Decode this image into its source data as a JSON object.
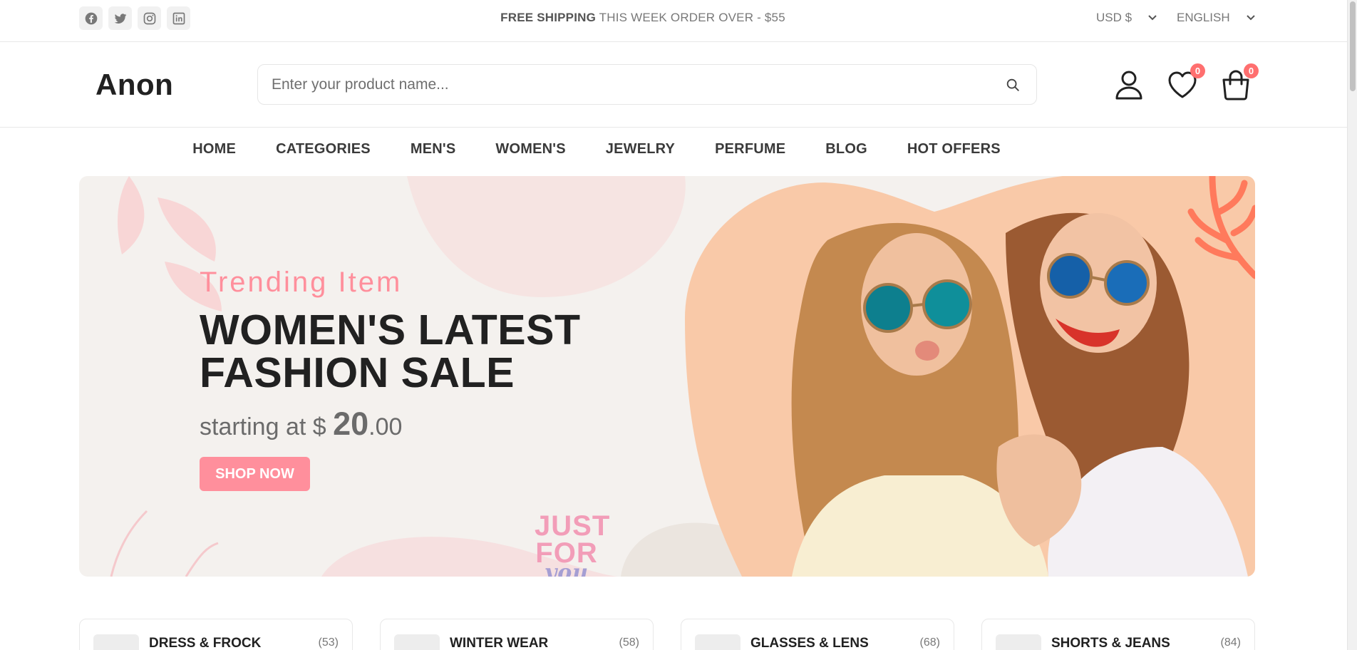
{
  "topbar": {
    "social_icons": [
      "facebook-icon",
      "twitter-icon",
      "instagram-icon",
      "linkedin-icon"
    ],
    "shipping_strong": "FREE SHIPPING",
    "shipping_rest": " THIS WEEK ORDER OVER - $55",
    "currency": "USD $",
    "language": "ENGLISH"
  },
  "header": {
    "logo": "Anon",
    "search_placeholder": "Enter your product name...",
    "wishlist_count": "0",
    "cart_count": "0"
  },
  "nav": {
    "items": [
      "HOME",
      "CATEGORIES",
      "MEN'S",
      "WOMEN'S",
      "JEWELRY",
      "PERFUME",
      "BLOG",
      "HOT OFFERS"
    ]
  },
  "banner": {
    "subtitle": "Trending Item",
    "title": "WOMEN'S LATEST FASHION SALE",
    "price_prefix": "starting at $ ",
    "price_whole": "20",
    "price_cents": ".00",
    "button": "SHOP NOW",
    "sticker_line1": "JUST",
    "sticker_line2": "FOR",
    "sticker_line3": "you"
  },
  "categories": [
    {
      "name": "DRESS & FROCK",
      "count": "(53)"
    },
    {
      "name": "WINTER WEAR",
      "count": "(58)"
    },
    {
      "name": "GLASSES & LENS",
      "count": "(68)"
    },
    {
      "name": "SHORTS & JEANS",
      "count": "(84)"
    }
  ],
  "colors": {
    "accent": "#ff8f9c",
    "badge": "#ff6f6f",
    "text": "#212121"
  }
}
